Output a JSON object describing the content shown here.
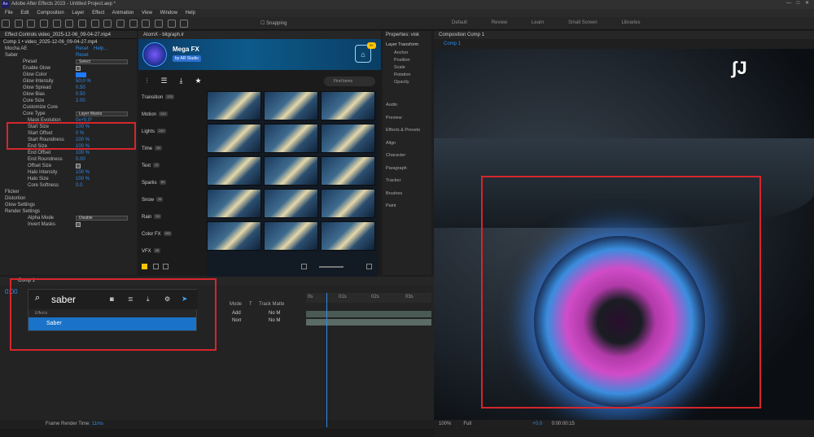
{
  "window": {
    "title": "Adobe After Effects 2023 - Untitled Project.aep *",
    "app_badge": "Ae"
  },
  "menu": [
    "File",
    "Edit",
    "Composition",
    "Layer",
    "Effect",
    "Animation",
    "View",
    "Window",
    "Help"
  ],
  "toolbar": {
    "snapping_label": "Snapping"
  },
  "workspaces": [
    "Default",
    "Review",
    "Learn",
    "Small Screen",
    "Libraries"
  ],
  "effect_controls": {
    "tab_label": "Effect Controls video_2025-12-06_09-04-27.mp4",
    "comp_path": "Comp 1 • video_2025-12-06_09-04-27.mp4",
    "rows": [
      {
        "label": "Mocha AE",
        "value": "Reset",
        "extra": "Help..."
      },
      {
        "label": "Saber",
        "value": "Reset"
      },
      {
        "label": "Preset",
        "dropdown": "Select"
      },
      {
        "label": "Enable Glow",
        "checkbox": true
      },
      {
        "label": "Glow Color",
        "swatch": true
      },
      {
        "label": "Glow Intensity",
        "value": "50.0 %"
      },
      {
        "label": "Glow Spread",
        "value": "0.50"
      },
      {
        "label": "Glow Bias",
        "value": "0.50"
      },
      {
        "label": "Core Size",
        "value": "2.00"
      },
      {
        "label": "Customize Core"
      },
      {
        "label": "Core Type",
        "dropdown": "Layer Masks"
      },
      {
        "label": "Mask Evolution",
        "value": "0x+0.0°"
      },
      {
        "label": "Start Size",
        "value": "100 %"
      },
      {
        "label": "Start Offset",
        "value": "0 %"
      },
      {
        "label": "Start Roundness",
        "value": "100 %"
      },
      {
        "label": "End Size",
        "value": "100 %"
      },
      {
        "label": "End Offset",
        "value": "100 %"
      },
      {
        "label": "End Roundness",
        "value": "0.00"
      },
      {
        "label": "Offset Size",
        "checkbox": true
      },
      {
        "label": "Halo Intensity",
        "value": "100 %"
      },
      {
        "label": "Halo Size",
        "value": "100 %"
      },
      {
        "label": "Core Softness",
        "value": "0.0"
      },
      {
        "label": "Flicker"
      },
      {
        "label": "Distortion"
      },
      {
        "label": "Glow Settings"
      },
      {
        "label": "Render Settings"
      },
      {
        "label": "Alpha Mode",
        "dropdown": "Disable"
      },
      {
        "label": "Invert Masks",
        "checkbox": true
      }
    ]
  },
  "atomx": {
    "tab_label": "AtomX - bitgraph.ir",
    "title": "Mega FX",
    "subtitle": "by AR Studio",
    "bag_badge": "5+",
    "search_placeholder": "Find items",
    "categories": [
      {
        "label": "Transition",
        "count": "133"
      },
      {
        "label": "Motion",
        "count": "142"
      },
      {
        "label": "Lights",
        "count": "140"
      },
      {
        "label": "Time",
        "count": "16"
      },
      {
        "label": "Text",
        "count": "12"
      },
      {
        "label": "Sparks",
        "count": "84"
      },
      {
        "label": "Snow",
        "count": "16"
      },
      {
        "label": "Rain",
        "count": "30"
      },
      {
        "label": "Color FX",
        "count": "355"
      },
      {
        "label": "VFX",
        "count": "46"
      }
    ]
  },
  "properties": {
    "tab_label": "Properties: visk",
    "layer_label": "Layer Transform",
    "transform": [
      "Anchor",
      "Position",
      "Scale",
      "Rotation",
      "Opacity"
    ],
    "panels": [
      "Audio",
      "Preview",
      "Effects & Presets",
      "Align",
      "Character",
      "Paragraph",
      "Tracker",
      "Brushes",
      "Paint"
    ]
  },
  "composition": {
    "tab_label": "Composition Comp 1",
    "sub_tab": "Comp 1",
    "zoom": "100%",
    "resolution": "Full",
    "timecode": "0:00:00:15",
    "exposure": "+0.0"
  },
  "timeline": {
    "tab_label": "Comp 1",
    "timecode": "0:00",
    "ruler": [
      "0s",
      "01s",
      "02s",
      "03s"
    ],
    "columns": [
      "Mode",
      "T",
      "Track Matte"
    ],
    "layers": [
      {
        "mode": "Add",
        "matte": "No M"
      },
      {
        "mode": "Norr",
        "matte": "No M"
      }
    ],
    "render_time_label": "Frame Render Time:",
    "render_time_value": "11ms"
  },
  "search_popup": {
    "query": "saber",
    "section": "Effects",
    "result": "Saber"
  }
}
